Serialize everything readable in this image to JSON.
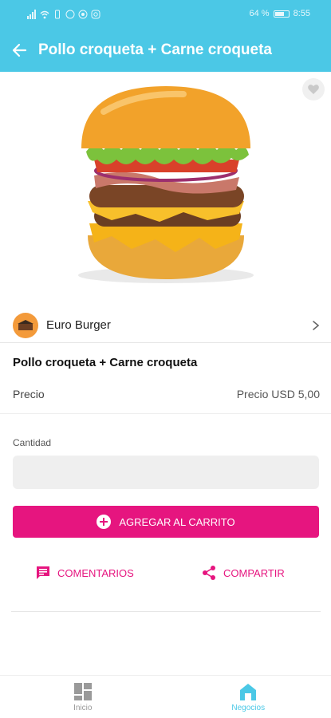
{
  "status_bar": {
    "battery": "64 %",
    "time": "8:55"
  },
  "app_bar": {
    "title": "Pollo croqueta + Carne croqueta"
  },
  "store": {
    "name": "Euro Burger"
  },
  "product": {
    "name": "Pollo croqueta + Carne croqueta",
    "price_label": "Precio",
    "price_value": "Precio USD 5,00"
  },
  "quantity": {
    "label": "Cantidad",
    "value": ""
  },
  "buttons": {
    "add_to_cart": "AGREGAR AL CARRITO",
    "comments": "COMENTARIOS",
    "share": "COMPARTIR"
  },
  "bottom_nav": {
    "items": [
      {
        "label": "Inicio",
        "icon": "grid-icon"
      },
      {
        "label": "Negocios",
        "icon": "store-icon"
      }
    ]
  },
  "colors": {
    "primary": "#4bc8e6",
    "accent": "#e6157f"
  }
}
